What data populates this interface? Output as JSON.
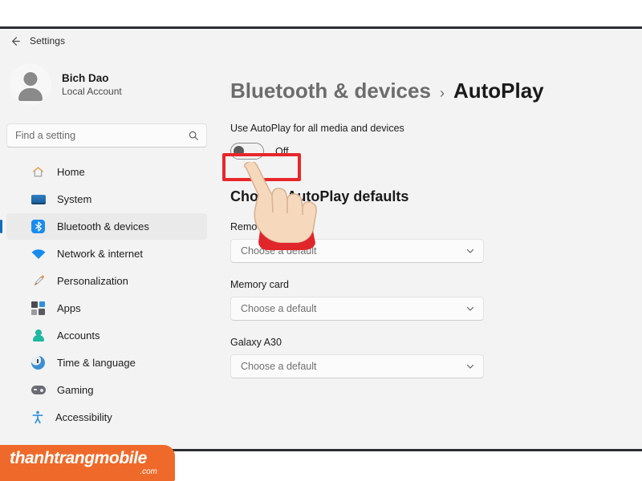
{
  "window": {
    "titlebar": {
      "back_icon": "back-arrow-icon",
      "title": "Settings"
    }
  },
  "sidebar": {
    "profile": {
      "avatar_icon": "user-avatar-icon",
      "name": "Bich Dao",
      "account_type": "Local Account"
    },
    "search": {
      "placeholder": "Find a setting",
      "value": "",
      "icon": "search-icon"
    },
    "items": [
      {
        "label": "Home",
        "icon": "home-icon",
        "selected": false
      },
      {
        "label": "System",
        "icon": "monitor-icon",
        "selected": false
      },
      {
        "label": "Bluetooth & devices",
        "icon": "bluetooth-icon",
        "selected": true
      },
      {
        "label": "Network & internet",
        "icon": "wifi-icon",
        "selected": false
      },
      {
        "label": "Personalization",
        "icon": "paintbrush-icon",
        "selected": false
      },
      {
        "label": "Apps",
        "icon": "apps-grid-icon",
        "selected": false
      },
      {
        "label": "Accounts",
        "icon": "person-icon",
        "selected": false
      },
      {
        "label": "Time & language",
        "icon": "clock-icon",
        "selected": false
      },
      {
        "label": "Gaming",
        "icon": "gamepad-icon",
        "selected": false
      },
      {
        "label": "Accessibility",
        "icon": "accessibility-icon",
        "selected": false
      }
    ]
  },
  "content": {
    "breadcrumb": {
      "parent": "Bluetooth & devices",
      "separator": "›",
      "current": "AutoPlay"
    },
    "autoplay_toggle": {
      "label": "Use AutoPlay for all media and devices",
      "state_label": "Off",
      "state": "off"
    },
    "defaults_heading": "Choose AutoPlay defaults",
    "fields": [
      {
        "label": "Removable drive",
        "value": "Choose a default",
        "chevron_icon": "chevron-down-icon"
      },
      {
        "label": "Memory card",
        "value": "Choose a default",
        "chevron_icon": "chevron-down-icon"
      },
      {
        "label": "Galaxy A30",
        "value": "Choose a default",
        "chevron_icon": "chevron-down-icon"
      }
    ]
  },
  "annotations": {
    "highlight_box": {
      "name": "red-highlight-box",
      "color": "#e8262a"
    },
    "pointer": {
      "name": "pointing-hand-cursor",
      "skin_color": "#f6d9bd",
      "sleeve_color": "#e0262b"
    }
  },
  "watermark": {
    "brand": "thanhtrangmobile",
    "tld": ".com",
    "color": "#ef6a2a"
  },
  "theme": {
    "accent": "#0f6cbd",
    "background": "#f3f3f3",
    "selected_row": "#eaeaea"
  }
}
